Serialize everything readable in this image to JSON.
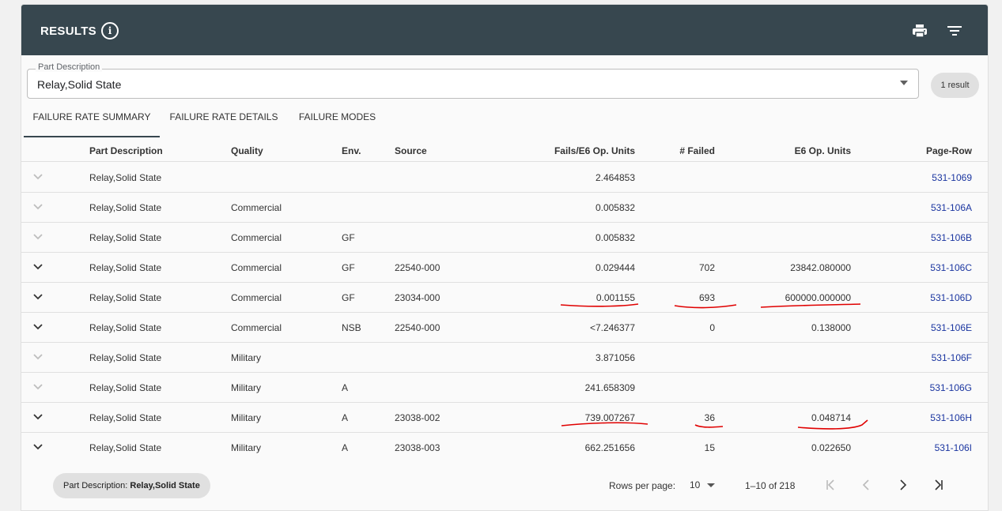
{
  "header": {
    "title": "RESULTS",
    "icons": [
      "info-icon",
      "print-icon",
      "filter-icon"
    ]
  },
  "search": {
    "label": "Part Description",
    "value": "Relay,Solid State"
  },
  "result_count": "1 result",
  "tabs": [
    {
      "label": "FAILURE RATE SUMMARY",
      "active": true
    },
    {
      "label": "FAILURE RATE DETAILS",
      "active": false
    },
    {
      "label": "FAILURE MODES",
      "active": false
    }
  ],
  "columns": {
    "part": "Part Description",
    "quality": "Quality",
    "env": "Env.",
    "source": "Source",
    "fails": "Fails/E6 Op. Units",
    "failed": "# Failed",
    "units": "E6 Op. Units",
    "pagerow": "Page-Row"
  },
  "rows": [
    {
      "part": "Relay,Solid State",
      "quality": "",
      "env": "",
      "source": "",
      "fails": "2.464853",
      "failed": "",
      "units": "",
      "pagerow": "531-1069",
      "expandable": false
    },
    {
      "part": "Relay,Solid State",
      "quality": "Commercial",
      "env": "",
      "source": "",
      "fails": "0.005832",
      "failed": "",
      "units": "",
      "pagerow": "531-106A",
      "expandable": false
    },
    {
      "part": "Relay,Solid State",
      "quality": "Commercial",
      "env": "GF",
      "source": "",
      "fails": "0.005832",
      "failed": "",
      "units": "",
      "pagerow": "531-106B",
      "expandable": false
    },
    {
      "part": "Relay,Solid State",
      "quality": "Commercial",
      "env": "GF",
      "source": "22540-000",
      "fails": "0.029444",
      "failed": "702",
      "units": "23842.080000",
      "pagerow": "531-106C",
      "expandable": true
    },
    {
      "part": "Relay,Solid State",
      "quality": "Commercial",
      "env": "GF",
      "source": "23034-000",
      "fails": "0.001155",
      "failed": "693",
      "units": "600000.000000",
      "pagerow": "531-106D",
      "expandable": true
    },
    {
      "part": "Relay,Solid State",
      "quality": "Commercial",
      "env": "NSB",
      "source": "22540-000",
      "fails": "<7.246377",
      "failed": "0",
      "units": "0.138000",
      "pagerow": "531-106E",
      "expandable": true
    },
    {
      "part": "Relay,Solid State",
      "quality": "Military",
      "env": "",
      "source": "",
      "fails": "3.871056",
      "failed": "",
      "units": "",
      "pagerow": "531-106F",
      "expandable": false
    },
    {
      "part": "Relay,Solid State",
      "quality": "Military",
      "env": "A",
      "source": "",
      "fails": "241.658309",
      "failed": "",
      "units": "",
      "pagerow": "531-106G",
      "expandable": false
    },
    {
      "part": "Relay,Solid State",
      "quality": "Military",
      "env": "A",
      "source": "23038-002",
      "fails": "739.007267",
      "failed": "36",
      "units": "0.048714",
      "pagerow": "531-106H",
      "expandable": true
    },
    {
      "part": "Relay,Solid State",
      "quality": "Military",
      "env": "A",
      "source": "23038-003",
      "fails": "662.251656",
      "failed": "15",
      "units": "0.022650",
      "pagerow": "531-106I",
      "expandable": true
    }
  ],
  "footer": {
    "filter_chip_label": "Part Description:",
    "filter_chip_value": "Relay,Solid State",
    "rows_per_page_label": "Rows per page:",
    "rows_per_page_value": "10",
    "range": "1–10 of 218"
  },
  "colors": {
    "header_bg": "#37474f",
    "link": "#1a35a0",
    "annotation": "#e00000"
  }
}
